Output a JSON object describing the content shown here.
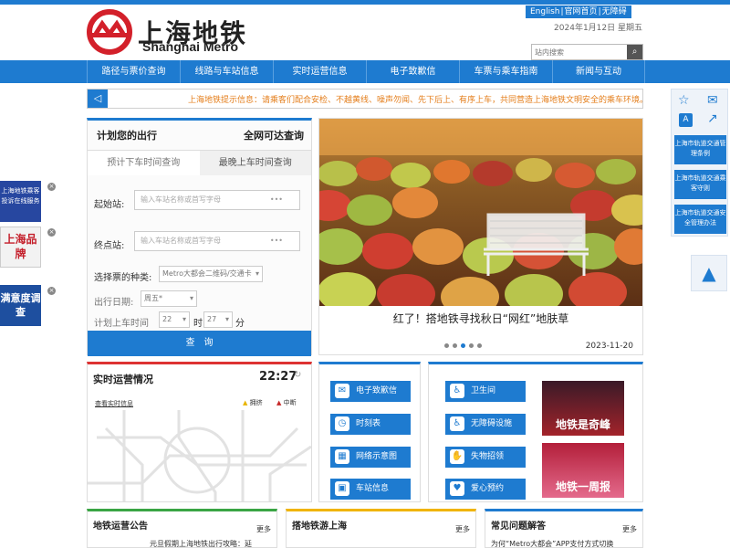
{
  "header": {
    "logo_cn": "上海地铁",
    "logo_en": "Shanghai Metro",
    "top_links": [
      "English",
      "官网首页",
      "无障碍"
    ],
    "date": "2024年1月12日 星期五",
    "search_placeholder": "站内搜索",
    "colors": {
      "brand_blue": "#1e7bd0",
      "logo_red": "#d3202a"
    }
  },
  "nav": {
    "items": [
      "路径与票价查询",
      "线路与车站信息",
      "实时运营信息",
      "电子致歉信",
      "车票与乘车指南",
      "新闻与互动"
    ]
  },
  "notice": {
    "icon": "speaker-icon",
    "text": "上海地铁提示信息：请乘客们配合安检、不越黄线、噪声勿闻、先下后上、有序上车，共同营造上海地铁文明安全的乘车环境。"
  },
  "planner": {
    "title": "计划您的出行",
    "title_right": "全网可达查询",
    "tabs": [
      "预计下车时间查询",
      "最晚上车时间查询"
    ],
    "from_label": "起始站:",
    "from_placeholder": "输入车站名称或首写字母",
    "to_label": "终点站:",
    "to_placeholder": "输入车站名称或首写字母",
    "ticket_label": "选择票的种类:",
    "ticket_value": "Metro大都会二维码/交通卡",
    "date_label": "出行日期:",
    "date_value": "周五*",
    "time_label": "计划上车时间",
    "hour_value": "22",
    "hour_unit": "时",
    "minute_value": "27",
    "minute_unit": "分",
    "submit": "查　询"
  },
  "banner": {
    "caption": "红了！搭地铁寻找秋日“网红”地肤草",
    "date": "2023-11-20",
    "slide_count": 5,
    "active_slide": 3
  },
  "status": {
    "title": "实时运营情况",
    "time": "22:27",
    "link": "查看实时信息",
    "legend_crowd": "拥挤",
    "legend_stop": "中断"
  },
  "services_left": [
    "电子致歉信",
    "时刻表",
    "网络示意图",
    "车站信息"
  ],
  "services_right": [
    "卫生间",
    "无障碍设施",
    "失物招领",
    "爱心预约"
  ],
  "videos": [
    {
      "label": "地铁是奇峰"
    },
    {
      "label": "地铁一周报"
    }
  ],
  "bottom": [
    {
      "title": "地铁运营公告",
      "more": "更多",
      "first": "元旦假期上海地铁出行攻略：延"
    },
    {
      "title": "搭地铁游上海",
      "more": "更多",
      "first": ""
    },
    {
      "title": "常见问题解答",
      "more": "更多",
      "first": "为何“Metro大都会”APP支付方式切换"
    }
  ],
  "left_ads": [
    {
      "label": "上海地铁乘客投诉在线服务"
    },
    {
      "label": "上海品牌"
    },
    {
      "label": "满意度调查"
    }
  ],
  "right_bar": {
    "links": [
      "上海市轨道交通管理条例",
      "上海市轨道交通乘客守则",
      "上海市轨道交通安全管理办法"
    ]
  }
}
